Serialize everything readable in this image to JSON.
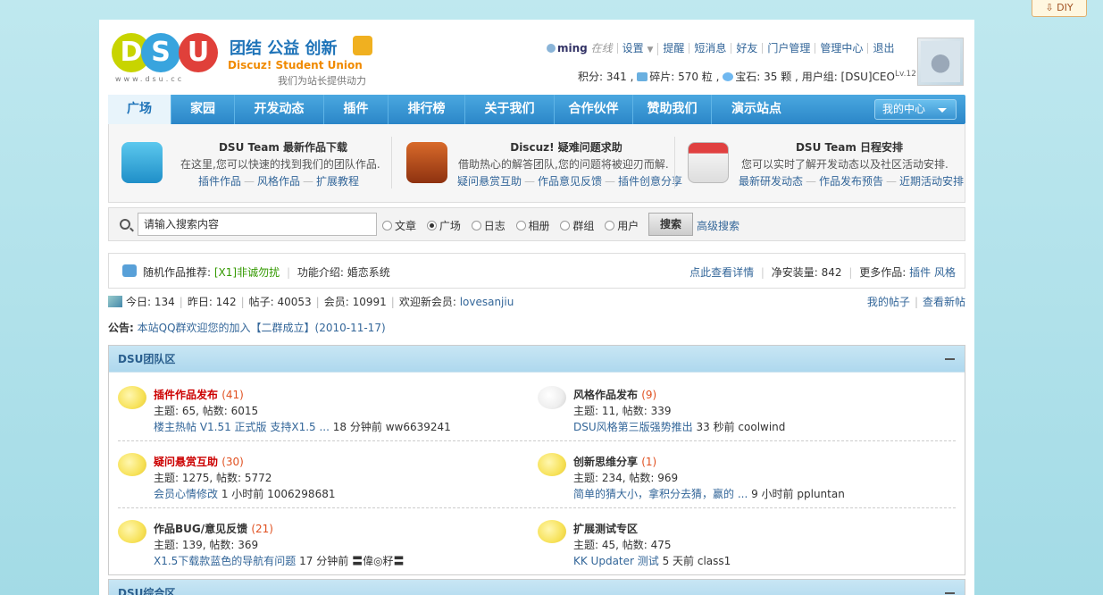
{
  "diy": {
    "label": "⇩ DIY"
  },
  "header": {
    "logo_letters": [
      "D",
      "S",
      "U"
    ],
    "logo_url": "www.dsu.cc",
    "slogan_cn": "团结 公益 创新",
    "slogan_en": "Discuz! Student Union",
    "slogan_sub": "我们为站长提供动力",
    "user": {
      "name": "ming",
      "status": "在线"
    },
    "user_menu": [
      "设置",
      "提醒",
      "短消息",
      "好友",
      "门户管理",
      "管理中心",
      "退出"
    ],
    "stats": {
      "points_label": "积分: 341 ,",
      "shards_label": "碎片: 570 粒 ,",
      "gems_label": "宝石: 35 颗 ,",
      "group_label": "用户组: [DSU]CEO",
      "level": "Lv.12"
    }
  },
  "nav": {
    "items": [
      "广场",
      "家园",
      "开发动态",
      "插件",
      "排行榜",
      "关于我们",
      "合作伙伴",
      "赞助我们",
      "演示站点"
    ],
    "active_index": 0,
    "my_center": "我的中心"
  },
  "promo": [
    {
      "title": "DSU Team 最新作品下载",
      "desc": "在这里,您可以快速的找到我们的团队作品.",
      "links": [
        "插件作品",
        "风格作品",
        "扩展教程"
      ],
      "icon": "cloud-icon",
      "color": "#2fa6d8"
    },
    {
      "title": "Discuz! 疑难问题求助",
      "desc": "借助热心的解答团队,您的问题将被迎刃而解.",
      "links": [
        "疑问悬赏互助",
        "作品意见反馈",
        "插件创意分享"
      ],
      "icon": "alert-icon",
      "color": "#b8481a"
    },
    {
      "title": "DSU Team 日程安排",
      "desc": "您可以实时了解开发动态以及社区活动安排.",
      "links": [
        "最新研发动态",
        "作品发布预告",
        "近期活动安排"
      ],
      "icon": "calendar-icon",
      "color": "#d03030"
    }
  ],
  "search": {
    "placeholder": "请输入搜索内容",
    "options": [
      "文章",
      "广场",
      "日志",
      "相册",
      "群组",
      "用户"
    ],
    "selected": "广场",
    "button": "搜索",
    "advanced": "高级搜索"
  },
  "recommend": {
    "label": "随机作品推荐:",
    "item": "[X1]非诚勿扰",
    "intro_label": "功能介绍:",
    "intro": "婚恋系统",
    "detail_link": "点此查看详情",
    "installs": "净安装量: 842",
    "more_label": "更多作品:",
    "more_links": [
      "插件",
      "风格"
    ]
  },
  "site_stats": {
    "today": "今日: 134",
    "yesterday": "昨日: 142",
    "posts": "帖子: 40053",
    "members": "会员: 10991",
    "welcome": "欢迎新会员:",
    "new_member": "lovesanjiu",
    "my_posts": "我的帖子",
    "new_posts": "查看新帖"
  },
  "notice": {
    "label": "公告:",
    "text": "本站QQ群欢迎您的加入【二群成立】(2010-11-17)"
  },
  "categories": [
    {
      "title": "DSU团队区",
      "forums": [
        {
          "name": "插件作品发布",
          "count": "(41)",
          "meta": "主题: 65, 帖数: 6015",
          "last_title": "楼主热帖 V1.51 正式版 支持X1.5 ...",
          "last_time": "18 分钟前",
          "last_user": "ww6639241",
          "style": "red",
          "bubble": "yellow"
        },
        {
          "name": "风格作品发布",
          "count": "(9)",
          "meta": "主题: 11, 帖数: 339",
          "last_title": "DSU风格第三版强势推出",
          "last_time": "33 秒前",
          "last_user": "coolwind",
          "style": "dark",
          "bubble": "grey"
        },
        {
          "name": "疑问悬赏互助",
          "count": "(30)",
          "meta": "主题: 1275, 帖数: 5772",
          "last_title": "会员心情修改",
          "last_time": "1 小时前",
          "last_user": "1006298681",
          "style": "red",
          "bubble": "yellow"
        },
        {
          "name": "创新思维分享",
          "count": "(1)",
          "meta": "主题: 234, 帖数: 969",
          "last_title": "简单的猜大小，拿积分去猜，赢的 ...",
          "last_time": "9 小时前",
          "last_user": "ppluntan",
          "style": "dark",
          "bubble": "yellow"
        },
        {
          "name": "作品BUG/意见反馈",
          "count": "(21)",
          "meta": "主题: 139, 帖数: 369",
          "last_title": "X1.5下载款蓝色的导航有问题",
          "last_time": "17 分钟前",
          "last_user": "〓偉◎籽〓",
          "style": "dark",
          "bubble": "yellow"
        },
        {
          "name": "扩展测试专区",
          "count": "",
          "meta": "主题: 45, 帖数: 475",
          "last_title": "KK Updater 测试",
          "last_time": "5 天前",
          "last_user": "class1",
          "style": "dark",
          "bubble": "yellow"
        }
      ]
    },
    {
      "title": "DSU综合区",
      "forums": []
    }
  ]
}
